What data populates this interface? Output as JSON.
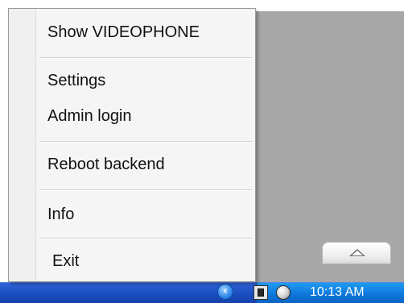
{
  "menu": {
    "items": [
      {
        "label": "Show VIDEOPHONE"
      },
      {
        "label": "Settings"
      },
      {
        "label": "Admin login"
      },
      {
        "label": "Reboot backend"
      },
      {
        "label": "Info"
      },
      {
        "label": "Exit"
      }
    ]
  },
  "tray": {
    "clock": "10:13 AM",
    "icons": [
      "chevron-left-icon",
      "app-tray-icon",
      "speaker-icon"
    ]
  },
  "colors": {
    "desktop": "#a7a7a7",
    "taskbar": "#1b4fbf",
    "tray": "#0f78dc",
    "menu_bg": "#f5f5f5"
  }
}
